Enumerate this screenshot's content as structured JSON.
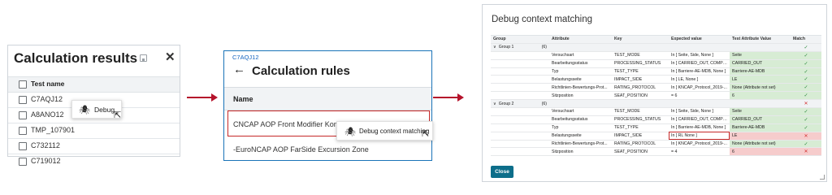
{
  "panel1": {
    "title": "Calculation results",
    "save_icon": "save-icon",
    "close_icon": "close-icon",
    "close_glyph": "✕",
    "column_header": "Test name",
    "rows": [
      "C7AQJ12",
      "A8ANO12",
      "TMP_107901",
      "C732112",
      "C719012"
    ],
    "context_menu": {
      "label": "Debug",
      "icon": "bug-icon",
      "glyph": "🕷"
    },
    "cursor_glyph": "⇱"
  },
  "panel2": {
    "breadcrumb": "C7AQJ12",
    "back_glyph": "←",
    "title": "Calculation rules",
    "column_header": "Name",
    "rows": [
      "CNCAP AOP Front Modifier Kompatibilität",
      "-EuroNCAP AOP FarSide Excursion Zone"
    ],
    "context_menu": {
      "label": "Debug context matching",
      "icon": "bug-icon",
      "glyph": "🕷"
    }
  },
  "panel3": {
    "title": "Debug context matching",
    "columns": [
      "Group",
      "Attribute",
      "Key",
      "Expected value",
      "Test Attribute Value",
      "Match"
    ],
    "groups": [
      {
        "name": "Group 1",
        "count": "(6)",
        "rows": [
          {
            "attribute": "Versuchsart",
            "key": "TEST_MODE",
            "expected": "In [ Seite, Side, None ]",
            "value": "Seite",
            "match": "✓",
            "ok": true
          },
          {
            "attribute": "Bearbeitungsstatus",
            "key": "PROCESSING_STATUS",
            "expected": "In [ CARRIED_OUT, COMPLE...",
            "value": "CARRIED_OUT",
            "match": "✓",
            "ok": true
          },
          {
            "attribute": "Typ",
            "key": "TEST_TYPE",
            "expected": "In [ Barriere-AE-MDB, None ]",
            "value": "Barriere-AE-MDB",
            "match": "✓",
            "ok": true
          },
          {
            "attribute": "Belastungsseite",
            "key": "IMPACT_SIDE",
            "expected": "In [ LE, None ]",
            "value": "LE",
            "match": "✓",
            "ok": true
          },
          {
            "attribute": "Richtlinien-Bewertungs-Prot...",
            "key": "RATING_PROTOCOL",
            "expected": "In [ KNCAP_Protocol_2019-...",
            "value": "None (Attribute not set)",
            "match": "✓",
            "ok": true
          },
          {
            "attribute": "Sitzposition",
            "key": "SEAT_POSITION",
            "expected": "= 6",
            "value": "6",
            "match": "✓",
            "ok": true
          }
        ]
      },
      {
        "name": "Group 2",
        "count": "(6)",
        "rows": [
          {
            "attribute": "Versuchsart",
            "key": "TEST_MODE",
            "expected": "In [ Seite, Side, None ]",
            "value": "Seite",
            "match": "✓",
            "ok": true
          },
          {
            "attribute": "Bearbeitungsstatus",
            "key": "PROCESSING_STATUS",
            "expected": "In [ CARRIED_OUT, COMPLE...",
            "value": "CARRIED_OUT",
            "match": "✓",
            "ok": true
          },
          {
            "attribute": "Typ",
            "key": "TEST_TYPE",
            "expected": "In [ Barriere-AE-MDB, None ]",
            "value": "Barriere-AE-MDB",
            "match": "✓",
            "ok": true
          },
          {
            "attribute": "Belastungsseite",
            "key": "IMPACT_SIDE",
            "expected": "In [ RL None ]",
            "value": "LE",
            "match": "✕",
            "ok": false
          },
          {
            "attribute": "Richtlinien-Bewertungs-Prot...",
            "key": "RATING_PROTOCOL",
            "expected": "In [ KNCAP_Protocol_2019-...",
            "value": "None (Attribute not set)",
            "match": "✓",
            "ok": true
          },
          {
            "attribute": "Sitzposition",
            "key": "SEAT_POSITION",
            "expected": "= 4",
            "value": "6",
            "match": "✕",
            "ok": false
          }
        ]
      }
    ],
    "group_match": [
      "✓",
      "✕"
    ],
    "close_label": "Close"
  },
  "colors": {
    "accent": "#0d6e8a",
    "arrow": "#b5122b",
    "match_ok": "#d7ecd4",
    "match_bad": "#f6cccc",
    "link": "#1565c0"
  }
}
